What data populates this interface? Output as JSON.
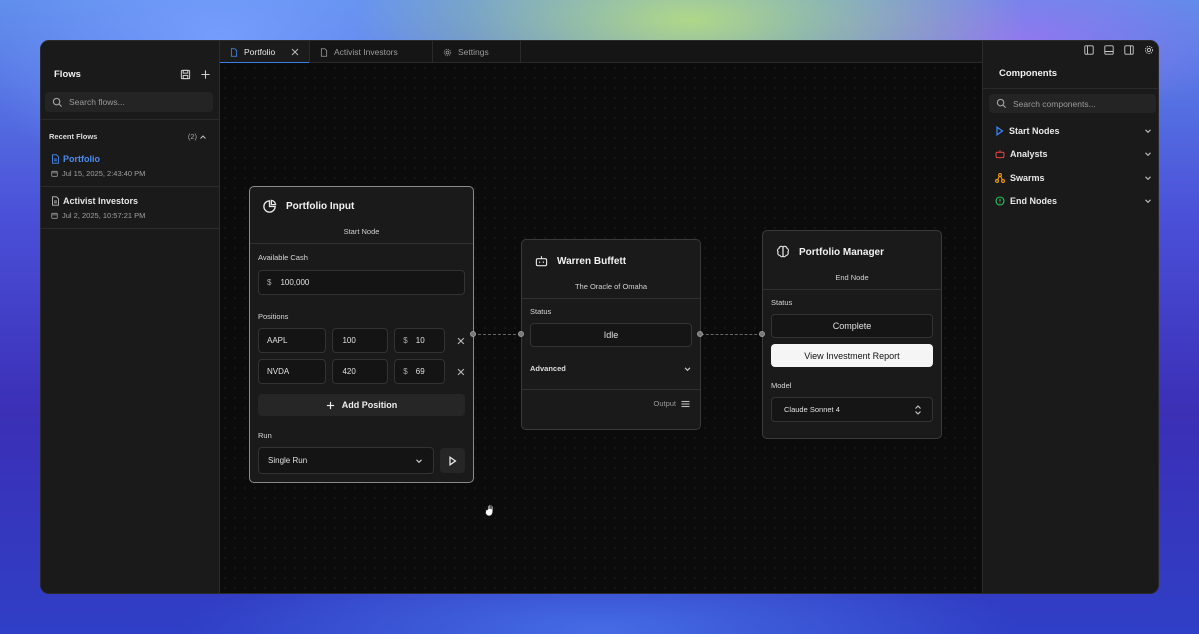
{
  "sidebar": {
    "title": "Flows",
    "search_placeholder": "Search flows...",
    "recent_label": "Recent Flows",
    "recent_count": "(2)",
    "flows": [
      {
        "name": "Portfolio",
        "date": "Jul 15, 2025, 2:43:40 PM",
        "active": true
      },
      {
        "name": "Activist Investors",
        "date": "Jul 2, 2025, 10:57:21 PM",
        "active": false
      }
    ]
  },
  "tabs": [
    {
      "label": "Portfolio",
      "icon": "file-icon",
      "active": true
    },
    {
      "label": "Activist Investors",
      "icon": "file-icon",
      "active": false
    },
    {
      "label": "Settings",
      "icon": "gear-icon",
      "active": false
    }
  ],
  "portfolio_node": {
    "title": "Portfolio Input",
    "subtitle": "Start Node",
    "cash_label": "Available Cash",
    "currency": "$",
    "cash_value": "100,000",
    "positions_label": "Positions",
    "positions": [
      {
        "ticker": "AAPL",
        "shares": "100",
        "price": "10"
      },
      {
        "ticker": "NVDA",
        "shares": "420",
        "price": "69"
      }
    ],
    "add_position_label": "Add Position",
    "run_label": "Run",
    "run_mode": "Single Run"
  },
  "analyst_node": {
    "title": "Warren Buffett",
    "subtitle": "The Oracle of Omaha",
    "status_label": "Status",
    "status_value": "Idle",
    "advanced_label": "Advanced",
    "output_label": "Output"
  },
  "manager_node": {
    "title": "Portfolio Manager",
    "subtitle": "End Node",
    "status_label": "Status",
    "status_value": "Complete",
    "report_button": "View Investment Report",
    "model_label": "Model",
    "model_value": "Claude Sonnet 4"
  },
  "components": {
    "title": "Components",
    "search_placeholder": "Search components...",
    "items": [
      {
        "label": "Start Nodes",
        "icon": "play-icon",
        "color": "#3b82f6"
      },
      {
        "label": "Analysts",
        "icon": "bot-icon",
        "color": "#ef4444"
      },
      {
        "label": "Swarms",
        "icon": "network-icon",
        "color": "#f59e0b"
      },
      {
        "label": "End Nodes",
        "icon": "info-circle-icon",
        "color": "#22c55e"
      }
    ]
  },
  "colors": {
    "accent": "#3a7ee6",
    "active_flow": "#4a8cf0"
  }
}
